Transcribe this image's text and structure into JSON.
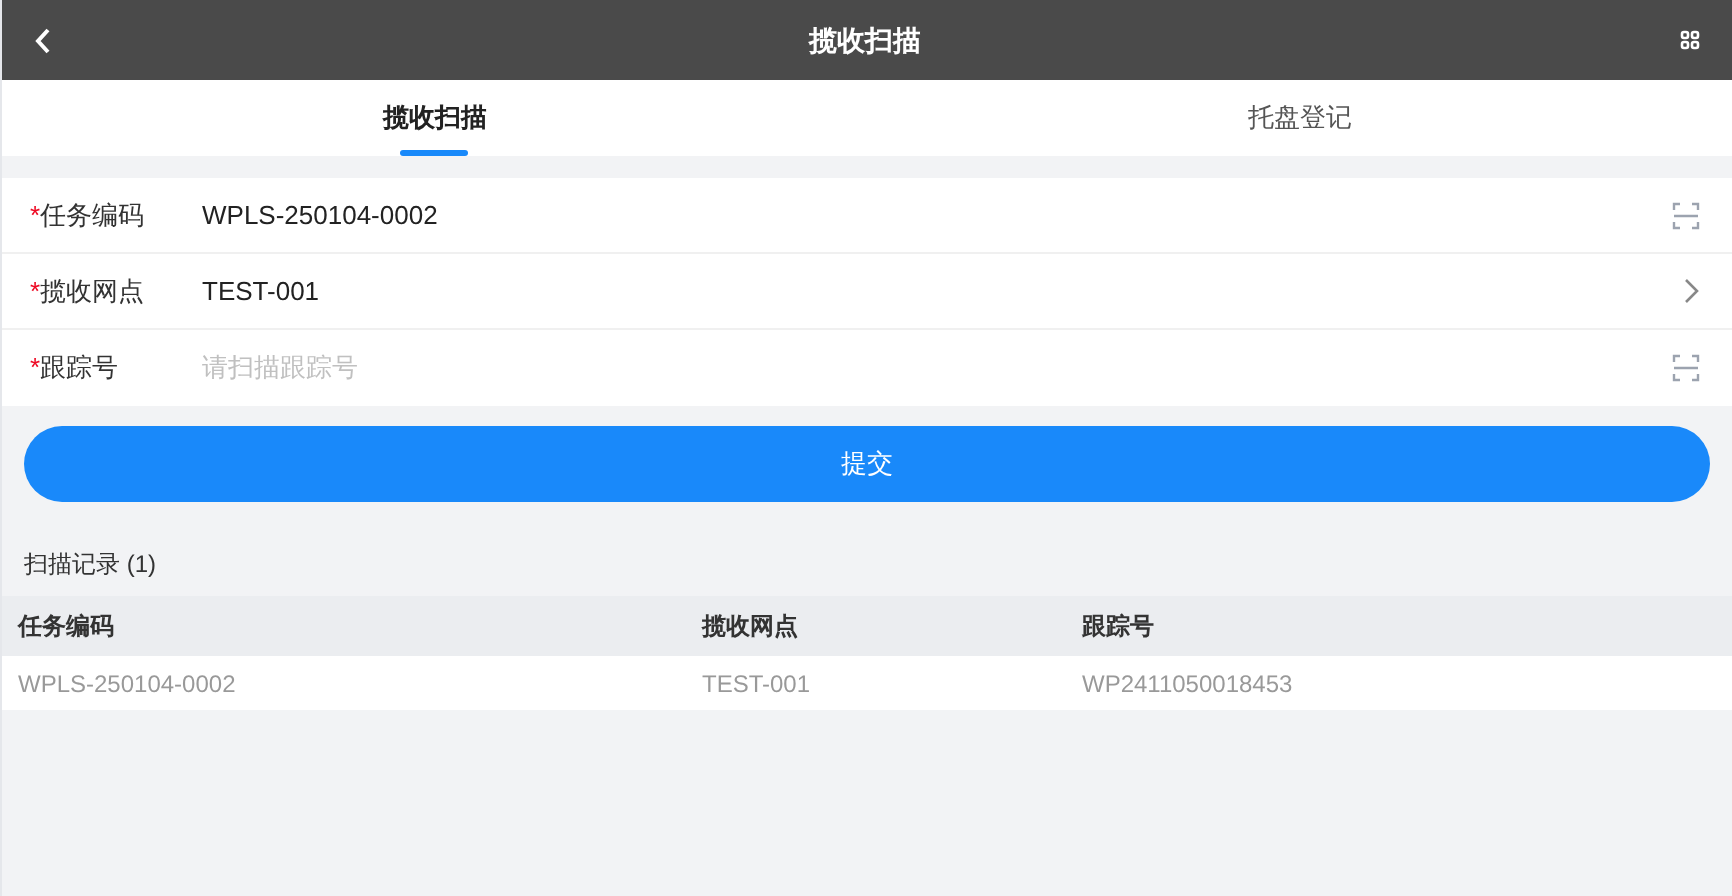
{
  "header": {
    "title": "揽收扫描"
  },
  "tabs": [
    {
      "label": "揽收扫描",
      "selected": true
    },
    {
      "label": "托盘登记",
      "selected": false
    }
  ],
  "form": [
    {
      "required_mark": "*",
      "label": "任务编码",
      "kind": "scan",
      "value": "WPLS-250104-0002"
    },
    {
      "required_mark": "*",
      "label": "揽收网点",
      "kind": "select",
      "value": "TEST-001"
    },
    {
      "required_mark": "*",
      "label": "跟踪号",
      "kind": "scan",
      "placeholder": "请扫描跟踪号"
    }
  ],
  "submit_button": "提交",
  "records": {
    "title": "扫描记录 (1)",
    "columns": [
      "任务编码",
      "揽收网点",
      "跟踪号"
    ],
    "rows": [
      [
        "WPLS-250104-0002",
        "TEST-001",
        "WP2411050018453"
      ]
    ]
  }
}
